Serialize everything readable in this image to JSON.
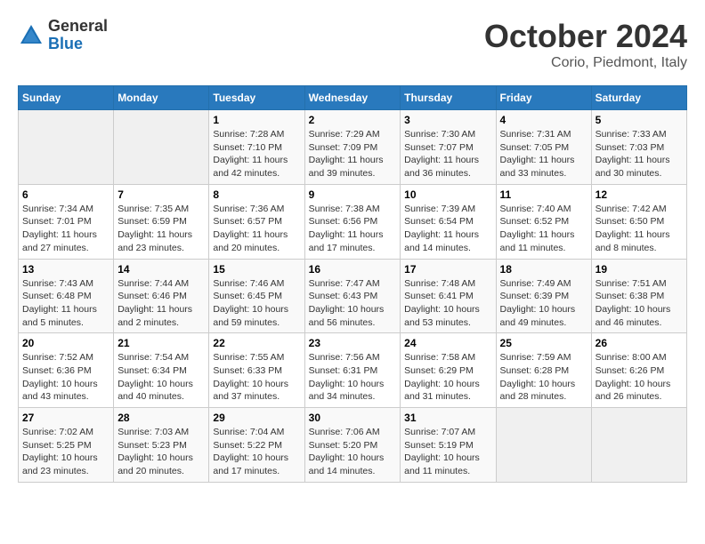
{
  "header": {
    "logo_general": "General",
    "logo_blue": "Blue",
    "month_title": "October 2024",
    "location": "Corio, Piedmont, Italy"
  },
  "calendar": {
    "headers": [
      "Sunday",
      "Monday",
      "Tuesday",
      "Wednesday",
      "Thursday",
      "Friday",
      "Saturday"
    ],
    "rows": [
      [
        {
          "day": "",
          "sunrise": "",
          "sunset": "",
          "daylight": "",
          "empty": true
        },
        {
          "day": "",
          "sunrise": "",
          "sunset": "",
          "daylight": "",
          "empty": true
        },
        {
          "day": "1",
          "sunrise": "Sunrise: 7:28 AM",
          "sunset": "Sunset: 7:10 PM",
          "daylight": "Daylight: 11 hours and 42 minutes.",
          "empty": false
        },
        {
          "day": "2",
          "sunrise": "Sunrise: 7:29 AM",
          "sunset": "Sunset: 7:09 PM",
          "daylight": "Daylight: 11 hours and 39 minutes.",
          "empty": false
        },
        {
          "day": "3",
          "sunrise": "Sunrise: 7:30 AM",
          "sunset": "Sunset: 7:07 PM",
          "daylight": "Daylight: 11 hours and 36 minutes.",
          "empty": false
        },
        {
          "day": "4",
          "sunrise": "Sunrise: 7:31 AM",
          "sunset": "Sunset: 7:05 PM",
          "daylight": "Daylight: 11 hours and 33 minutes.",
          "empty": false
        },
        {
          "day": "5",
          "sunrise": "Sunrise: 7:33 AM",
          "sunset": "Sunset: 7:03 PM",
          "daylight": "Daylight: 11 hours and 30 minutes.",
          "empty": false
        }
      ],
      [
        {
          "day": "6",
          "sunrise": "Sunrise: 7:34 AM",
          "sunset": "Sunset: 7:01 PM",
          "daylight": "Daylight: 11 hours and 27 minutes.",
          "empty": false
        },
        {
          "day": "7",
          "sunrise": "Sunrise: 7:35 AM",
          "sunset": "Sunset: 6:59 PM",
          "daylight": "Daylight: 11 hours and 23 minutes.",
          "empty": false
        },
        {
          "day": "8",
          "sunrise": "Sunrise: 7:36 AM",
          "sunset": "Sunset: 6:57 PM",
          "daylight": "Daylight: 11 hours and 20 minutes.",
          "empty": false
        },
        {
          "day": "9",
          "sunrise": "Sunrise: 7:38 AM",
          "sunset": "Sunset: 6:56 PM",
          "daylight": "Daylight: 11 hours and 17 minutes.",
          "empty": false
        },
        {
          "day": "10",
          "sunrise": "Sunrise: 7:39 AM",
          "sunset": "Sunset: 6:54 PM",
          "daylight": "Daylight: 11 hours and 14 minutes.",
          "empty": false
        },
        {
          "day": "11",
          "sunrise": "Sunrise: 7:40 AM",
          "sunset": "Sunset: 6:52 PM",
          "daylight": "Daylight: 11 hours and 11 minutes.",
          "empty": false
        },
        {
          "day": "12",
          "sunrise": "Sunrise: 7:42 AM",
          "sunset": "Sunset: 6:50 PM",
          "daylight": "Daylight: 11 hours and 8 minutes.",
          "empty": false
        }
      ],
      [
        {
          "day": "13",
          "sunrise": "Sunrise: 7:43 AM",
          "sunset": "Sunset: 6:48 PM",
          "daylight": "Daylight: 11 hours and 5 minutes.",
          "empty": false
        },
        {
          "day": "14",
          "sunrise": "Sunrise: 7:44 AM",
          "sunset": "Sunset: 6:46 PM",
          "daylight": "Daylight: 11 hours and 2 minutes.",
          "empty": false
        },
        {
          "day": "15",
          "sunrise": "Sunrise: 7:46 AM",
          "sunset": "Sunset: 6:45 PM",
          "daylight": "Daylight: 10 hours and 59 minutes.",
          "empty": false
        },
        {
          "day": "16",
          "sunrise": "Sunrise: 7:47 AM",
          "sunset": "Sunset: 6:43 PM",
          "daylight": "Daylight: 10 hours and 56 minutes.",
          "empty": false
        },
        {
          "day": "17",
          "sunrise": "Sunrise: 7:48 AM",
          "sunset": "Sunset: 6:41 PM",
          "daylight": "Daylight: 10 hours and 53 minutes.",
          "empty": false
        },
        {
          "day": "18",
          "sunrise": "Sunrise: 7:49 AM",
          "sunset": "Sunset: 6:39 PM",
          "daylight": "Daylight: 10 hours and 49 minutes.",
          "empty": false
        },
        {
          "day": "19",
          "sunrise": "Sunrise: 7:51 AM",
          "sunset": "Sunset: 6:38 PM",
          "daylight": "Daylight: 10 hours and 46 minutes.",
          "empty": false
        }
      ],
      [
        {
          "day": "20",
          "sunrise": "Sunrise: 7:52 AM",
          "sunset": "Sunset: 6:36 PM",
          "daylight": "Daylight: 10 hours and 43 minutes.",
          "empty": false
        },
        {
          "day": "21",
          "sunrise": "Sunrise: 7:54 AM",
          "sunset": "Sunset: 6:34 PM",
          "daylight": "Daylight: 10 hours and 40 minutes.",
          "empty": false
        },
        {
          "day": "22",
          "sunrise": "Sunrise: 7:55 AM",
          "sunset": "Sunset: 6:33 PM",
          "daylight": "Daylight: 10 hours and 37 minutes.",
          "empty": false
        },
        {
          "day": "23",
          "sunrise": "Sunrise: 7:56 AM",
          "sunset": "Sunset: 6:31 PM",
          "daylight": "Daylight: 10 hours and 34 minutes.",
          "empty": false
        },
        {
          "day": "24",
          "sunrise": "Sunrise: 7:58 AM",
          "sunset": "Sunset: 6:29 PM",
          "daylight": "Daylight: 10 hours and 31 minutes.",
          "empty": false
        },
        {
          "day": "25",
          "sunrise": "Sunrise: 7:59 AM",
          "sunset": "Sunset: 6:28 PM",
          "daylight": "Daylight: 10 hours and 28 minutes.",
          "empty": false
        },
        {
          "day": "26",
          "sunrise": "Sunrise: 8:00 AM",
          "sunset": "Sunset: 6:26 PM",
          "daylight": "Daylight: 10 hours and 26 minutes.",
          "empty": false
        }
      ],
      [
        {
          "day": "27",
          "sunrise": "Sunrise: 7:02 AM",
          "sunset": "Sunset: 5:25 PM",
          "daylight": "Daylight: 10 hours and 23 minutes.",
          "empty": false
        },
        {
          "day": "28",
          "sunrise": "Sunrise: 7:03 AM",
          "sunset": "Sunset: 5:23 PM",
          "daylight": "Daylight: 10 hours and 20 minutes.",
          "empty": false
        },
        {
          "day": "29",
          "sunrise": "Sunrise: 7:04 AM",
          "sunset": "Sunset: 5:22 PM",
          "daylight": "Daylight: 10 hours and 17 minutes.",
          "empty": false
        },
        {
          "day": "30",
          "sunrise": "Sunrise: 7:06 AM",
          "sunset": "Sunset: 5:20 PM",
          "daylight": "Daylight: 10 hours and 14 minutes.",
          "empty": false
        },
        {
          "day": "31",
          "sunrise": "Sunrise: 7:07 AM",
          "sunset": "Sunset: 5:19 PM",
          "daylight": "Daylight: 10 hours and 11 minutes.",
          "empty": false
        },
        {
          "day": "",
          "sunrise": "",
          "sunset": "",
          "daylight": "",
          "empty": true
        },
        {
          "day": "",
          "sunrise": "",
          "sunset": "",
          "daylight": "",
          "empty": true
        }
      ]
    ]
  }
}
